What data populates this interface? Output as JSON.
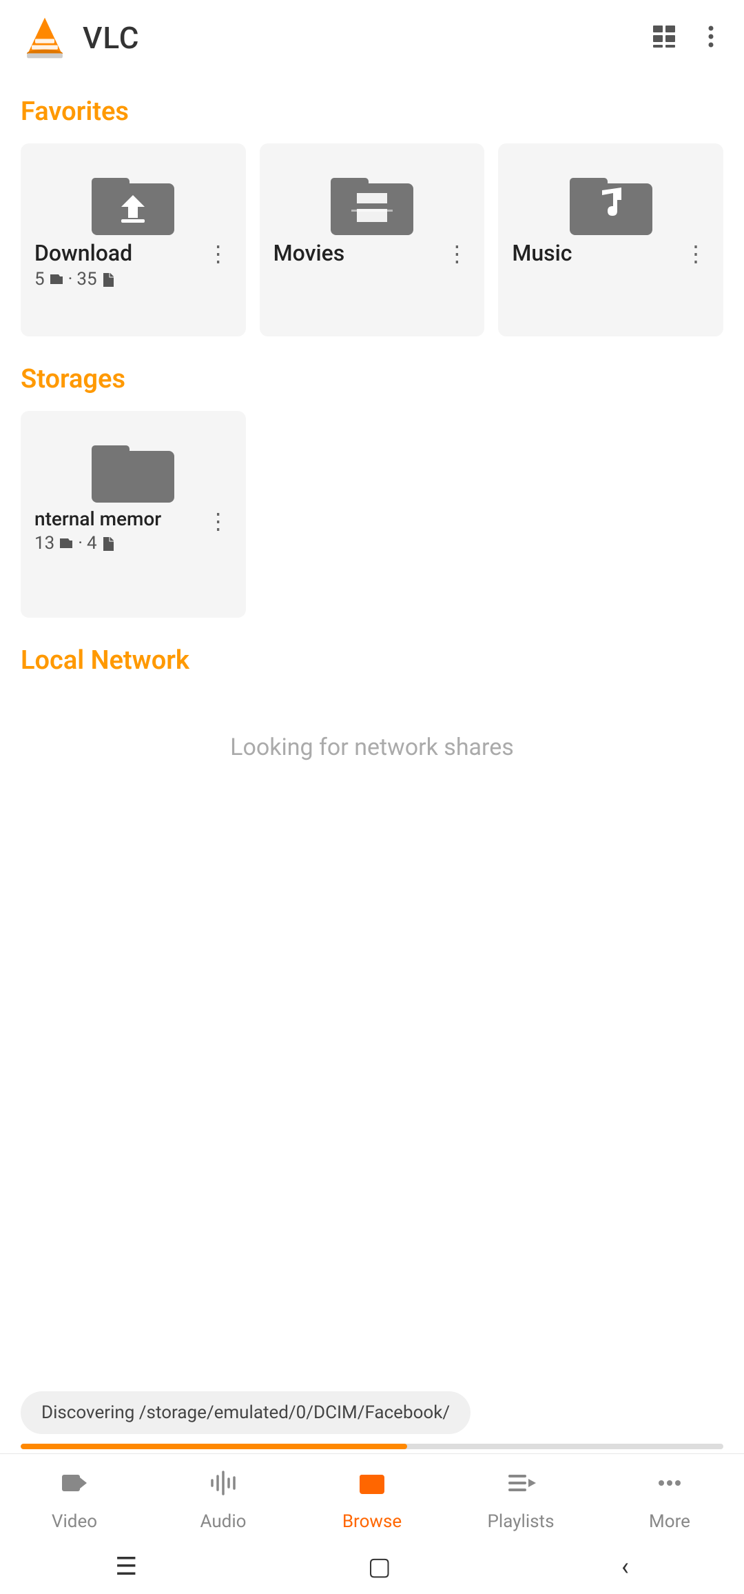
{
  "app": {
    "title": "VLC"
  },
  "sections": {
    "favorites": "Favorites",
    "storages": "Storages",
    "localNetwork": "Local Network"
  },
  "favorites": [
    {
      "name": "Download",
      "folders": "5",
      "files": "35",
      "type": "download"
    },
    {
      "name": "Movies",
      "folders": "",
      "files": "",
      "type": "movies"
    },
    {
      "name": "Music",
      "folders": "",
      "files": "",
      "type": "music"
    }
  ],
  "storages": [
    {
      "name": "Internal memory",
      "nameShort": "nternal memor",
      "folders": "13",
      "files": "4",
      "type": "storage"
    }
  ],
  "localNetwork": {
    "emptyText": "Looking for network shares"
  },
  "statusBar": {
    "text": "Discovering /storage/emulated/0/DCIM/Facebook/"
  },
  "bottomNav": [
    {
      "label": "Video",
      "icon": "video",
      "active": false
    },
    {
      "label": "Audio",
      "icon": "audio",
      "active": false
    },
    {
      "label": "Browse",
      "icon": "browse",
      "active": true
    },
    {
      "label": "Playlists",
      "icon": "playlists",
      "active": false
    },
    {
      "label": "More",
      "icon": "more",
      "active": false
    }
  ]
}
